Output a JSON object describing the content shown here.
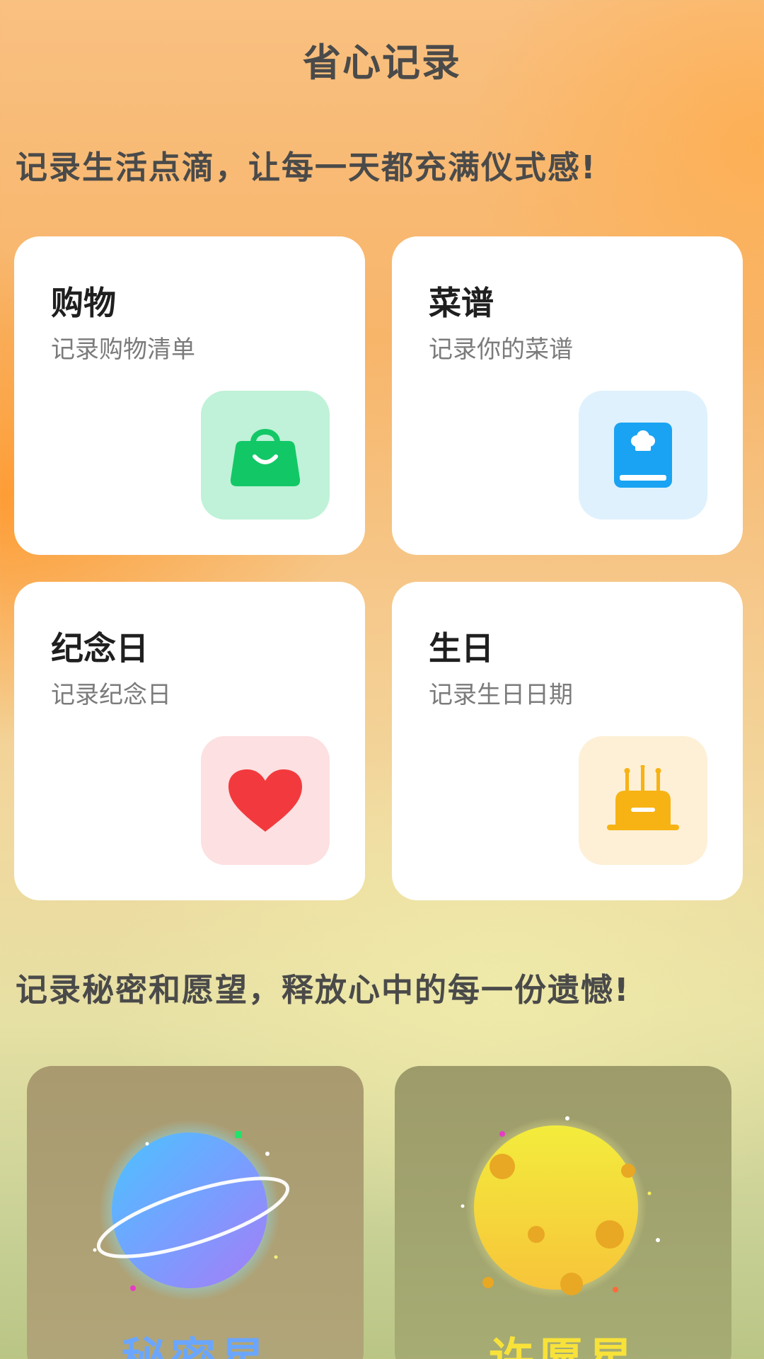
{
  "header": {
    "title": "省心记录"
  },
  "section1": {
    "tagline": "记录生活点滴，让每一天都充满仪式感!"
  },
  "cards": [
    {
      "title": "购物",
      "subtitle": "记录购物清单",
      "icon": "shopping-bag-icon",
      "icon_bg": "#bff2d8",
      "icon_color": "#12c866"
    },
    {
      "title": "菜谱",
      "subtitle": "记录你的菜谱",
      "icon": "recipe-book-icon",
      "icon_bg": "#dff1fd",
      "icon_color": "#1aa3f2"
    },
    {
      "title": "纪念日",
      "subtitle": "记录纪念日",
      "icon": "heart-icon",
      "icon_bg": "#fde0e1",
      "icon_color": "#f23a3e"
    },
    {
      "title": "生日",
      "subtitle": "记录生日日期",
      "icon": "birthday-cake-icon",
      "icon_bg": "#fdf0d6",
      "icon_color": "#f7b314"
    }
  ],
  "section2": {
    "tagline": "记录秘密和愿望，释放心中的每一份遗憾!"
  },
  "feature_cards": [
    {
      "label": "秘密星",
      "icon": "planet-icon",
      "label_color": "#6aa6ff"
    },
    {
      "label": "许愿星",
      "icon": "moon-icon",
      "label_color": "#f8e23a"
    }
  ]
}
